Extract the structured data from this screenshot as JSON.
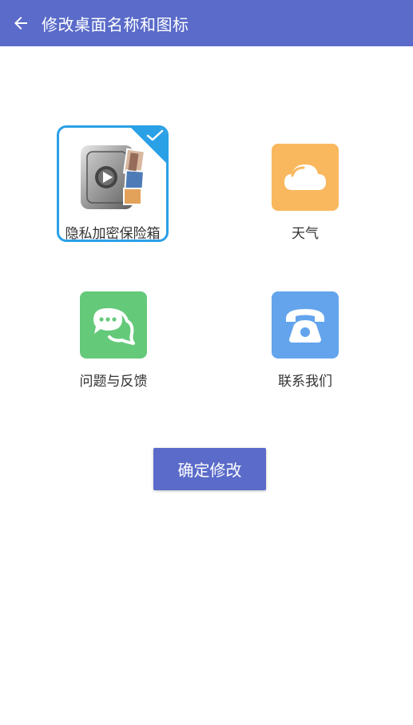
{
  "header": {
    "title": "修改桌面名称和图标",
    "accent": "#5a6bc9"
  },
  "apps": [
    {
      "label": "隐私加密保险箱",
      "icon": "safe-icon",
      "selected": true
    },
    {
      "label": "天气",
      "icon": "cloud-icon",
      "color": "#f9b85e",
      "selected": false
    },
    {
      "label": "问题与反馈",
      "icon": "chat-bubbles-icon",
      "color": "#65c97a",
      "selected": false
    },
    {
      "label": "联系我们",
      "icon": "telephone-icon",
      "color": "#63a4ed",
      "selected": false
    }
  ],
  "confirm_label": "确定修改",
  "selection_color": "#2aa0e6"
}
